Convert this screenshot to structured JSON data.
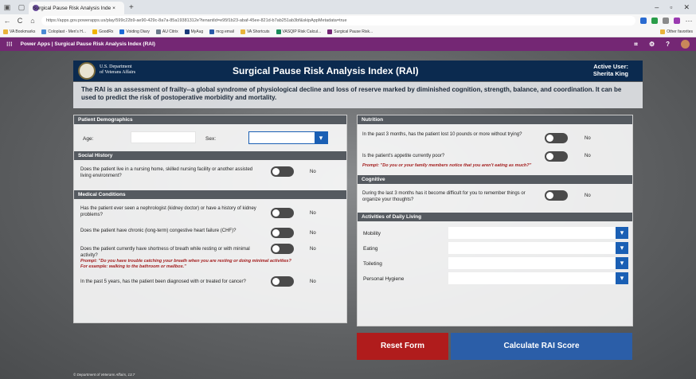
{
  "browser": {
    "tab_title": "Surgical Pause Risk Analysis Inde ×",
    "new_tab": "+",
    "url": "https://apps.gov.powerapps.us/play/599c22b9-ae90-429c-8a7a-85a19381312e?tenantId=e95f1b23-abaf-45ee-821d-b7ab251ab3bf&skipAppMetadata=true",
    "bookmarks": [
      "VA Bookmarks",
      "Coloplast - Men's H...",
      "GoodRx",
      "Voiding Diary",
      "AU Citrix",
      "MyAug",
      "mcg email",
      "VA Shortcuts",
      "VASQIP Risk Calcul...",
      "Surgical Pause Risk..."
    ],
    "other_bookmarks": "Other favorites"
  },
  "powerapps": {
    "title": "Power Apps | Surgical Pause Risk Analysis Index (RAI)"
  },
  "header": {
    "org_line1": "U.S. Department",
    "org_line2": "of Veterans Affairs",
    "title": "Surgical Pause Risk Analysis Index (RAI)",
    "user_label": "Active User:",
    "user_name": "Sherita King"
  },
  "description": "The RAI is an assessment of frailty--a global syndrome of physiological decline and loss of reserve marked by diminished cognition, strength, balance, and coordination. It can be used to predict the risk of postoperative morbidity and mortality.",
  "left": {
    "demographics": {
      "title": "Patient Demographics",
      "age_label": "Age:",
      "age_value": "",
      "sex_label": "Sex:",
      "sex_value": ""
    },
    "social": {
      "title": "Social History",
      "q1": "Does the patient live in a nursing home, skilled nursing facility or another assisted living environment?",
      "q1_value": "No"
    },
    "medical": {
      "title": "Medical Conditions",
      "q1": "Has the patient ever seen a nephrologist (kidney doctor) or have a history of kidney problems?",
      "q1_value": "No",
      "q2": "Does the patient have chronic (long-term) congestive heart failure (CHF)?",
      "q2_value": "No",
      "q3": "Does the patient currently have shortness of breath while resting or with minimal activity?",
      "q3_prompt": "Prompt: \"Do you have trouble catching your breath when you are resting or doing minimal activities? For example: walking to the bathroom or mailbox.\"",
      "q3_value": "No",
      "q4": "In the past 5 years, has the patient been diagnosed with or treated for cancer?",
      "q4_value": "No"
    }
  },
  "right": {
    "nutrition": {
      "title": "Nutrition",
      "q1": "In the past 3 months, has the patient lost 10 pounds or more without trying?",
      "q1_value": "No",
      "q2": "Is the patient's appetite currently poor?",
      "q2_prompt": "Prompt: \"Do you or your family members notice that you aren't eating as much?\"",
      "q2_value": "No"
    },
    "cognitive": {
      "title": "Cognitive",
      "q1": "During the last 3 months has it become difficult for you to remember things or organize your thoughts?",
      "q1_value": "No"
    },
    "adl": {
      "title": "Activities of Daily Living",
      "items": [
        "Mobility",
        "Eating",
        "Toileting",
        "Personal Hygiene"
      ]
    }
  },
  "buttons": {
    "reset": "Reset Form",
    "calculate": "Calculate RAI Score"
  },
  "footer": "© Department of Veterans Affairs, 13.7",
  "icons": {
    "dropdown": "▾",
    "back": "←",
    "refresh": "C",
    "home": "⌂"
  }
}
